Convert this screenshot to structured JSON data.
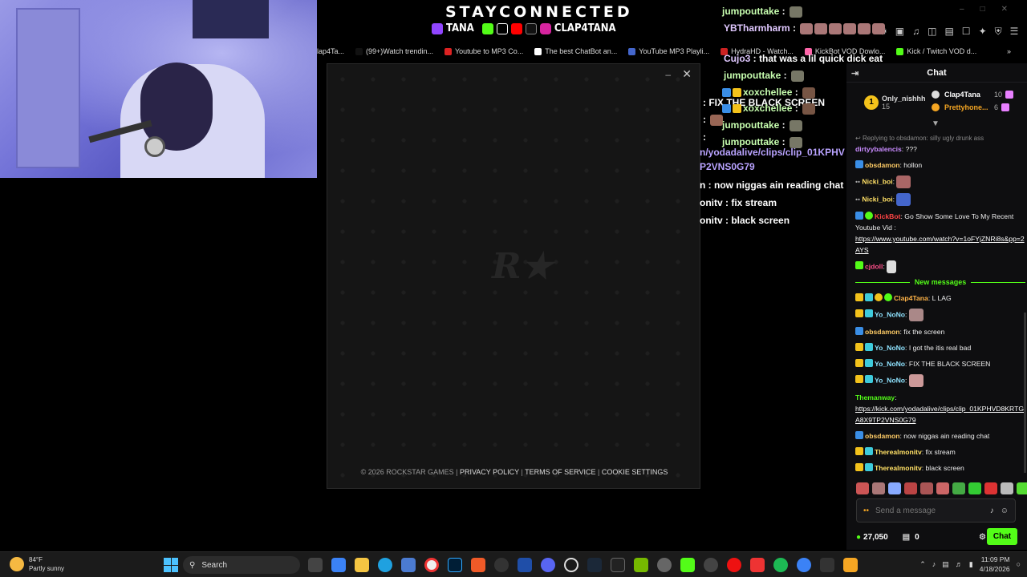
{
  "overlay": {
    "title": "STAYCONNECTED",
    "tag_left": "TANA",
    "tag_right": "CLAP4TANA"
  },
  "bookmarks": [
    {
      "label": "lap4Ta...",
      "color": "#888"
    },
    {
      "label": "(99+)Watch trendin...",
      "color": "#111"
    },
    {
      "label": "Youtube to MP3 Co...",
      "color": "#d22"
    },
    {
      "label": "The best ChatBot an...",
      "color": "#fff"
    },
    {
      "label": "YouTube MP3 Playli...",
      "color": "#46c"
    },
    {
      "label": "HydraHD - Watch...",
      "color": "#c22"
    },
    {
      "label": "KickBot VOD Dowlo...",
      "color": "#f6a"
    },
    {
      "label": "Kick / Twitch VOD d...",
      "color": "#53fc18"
    }
  ],
  "rockstar": {
    "logo": "R★",
    "footer_copy": "© 2026 ROCKSTAR GAMES",
    "privacy": "PRIVACY POLICY",
    "terms": "TERMS OF SERVICE",
    "cookie": "COOKIE SETTINGS"
  },
  "overlay_chat": [
    {
      "user": "jumpouttake",
      "text": ""
    },
    {
      "user": "YBTharmharm",
      "text": ""
    },
    {
      "user": "Cujo3",
      "text": "that was a lil quick dick eat"
    },
    {
      "user": "jumpouttake",
      "text": ""
    },
    {
      "user": "xoxchellee",
      "text": ""
    },
    {
      "user": "",
      "text": "FIX THE BLACK SCREEN"
    },
    {
      "user": "xoxchellee",
      "text": ""
    },
    {
      "user": "jumpouttake",
      "text": ""
    },
    {
      "user": "jumpouttake",
      "text": ""
    },
    {
      "user": "",
      "text": "n/yodadalive/clips/clip_01KPHV"
    },
    {
      "user": "",
      "text": "P2VNS0G79"
    },
    {
      "user": "",
      "text": "n : now niggas ain reading chat"
    },
    {
      "user": "",
      "text": "onitv : fix stream"
    },
    {
      "user": "",
      "text": "onitv : black screen"
    }
  ],
  "chat": {
    "title": "Chat",
    "pinned": {
      "gifter": "Only_nishhh",
      "gifter_count": "15",
      "top1": "Clap4Tana",
      "top1_count": "10",
      "top2": "Prettyhone...",
      "top2_count": "6"
    },
    "reply_text": "Replying to obsdamon: silly ugly drunk ass",
    "new_messages_label": "New messages",
    "messages_before": [
      {
        "name": "dirtyybalencis",
        "color": "#c98bff",
        "text": "???"
      },
      {
        "name": "obsdamon",
        "color": "#ffcc66",
        "text": "hollon"
      },
      {
        "name": "Nicki_boi",
        "color": "#ffe066",
        "text": ""
      },
      {
        "name": "Nicki_boi",
        "color": "#ffe066",
        "text": ""
      },
      {
        "name": "KickBot",
        "color": "#ff4444",
        "text": "Go Show Some Love To My Recent Youtube Vid :",
        "url": "https://www.youtube.com/watch?v=1oFYjZNRi8s&pp=2AYS"
      },
      {
        "name": "cjdoll",
        "color": "#ff4f8b",
        "text": ""
      }
    ],
    "messages_after": [
      {
        "name": "Clap4Tana",
        "color": "#ffb347",
        "text": "L LAG"
      },
      {
        "name": "Yo_NoNo",
        "color": "#8fe3ff",
        "text": ""
      },
      {
        "name": "obsdamon",
        "color": "#ffcc66",
        "text": "fix the screen"
      },
      {
        "name": "Yo_NoNo",
        "color": "#8fe3ff",
        "text": "I got the itis real bad"
      },
      {
        "name": "Yo_NoNo",
        "color": "#8fe3ff",
        "text": "FIX THE BLACK SCREEN"
      },
      {
        "name": "Yo_NoNo",
        "color": "#8fe3ff",
        "text": ""
      },
      {
        "name": "Themanway",
        "color": "#53fc18",
        "text": "",
        "url": "https://kick.com/yodadalive/clips/clip_01KPHVD8KRTGA8X9TP2VNS0G79"
      },
      {
        "name": "obsdamon",
        "color": "#ffcc66",
        "text": "now niggas ain reading chat"
      },
      {
        "name": "Therealmonitv",
        "color": "#ffe066",
        "text": "fix stream"
      },
      {
        "name": "Therealmonitv",
        "color": "#ffe066",
        "text": "black screen"
      }
    ],
    "input_placeholder": "Send a message",
    "points": "27,050",
    "gifts": "0",
    "send_label": "Chat"
  },
  "taskbar": {
    "temperature": "84°F",
    "weather": "Partly sunny",
    "search": "Search",
    "time": "11:09 PM",
    "date": "4/18/2026"
  }
}
